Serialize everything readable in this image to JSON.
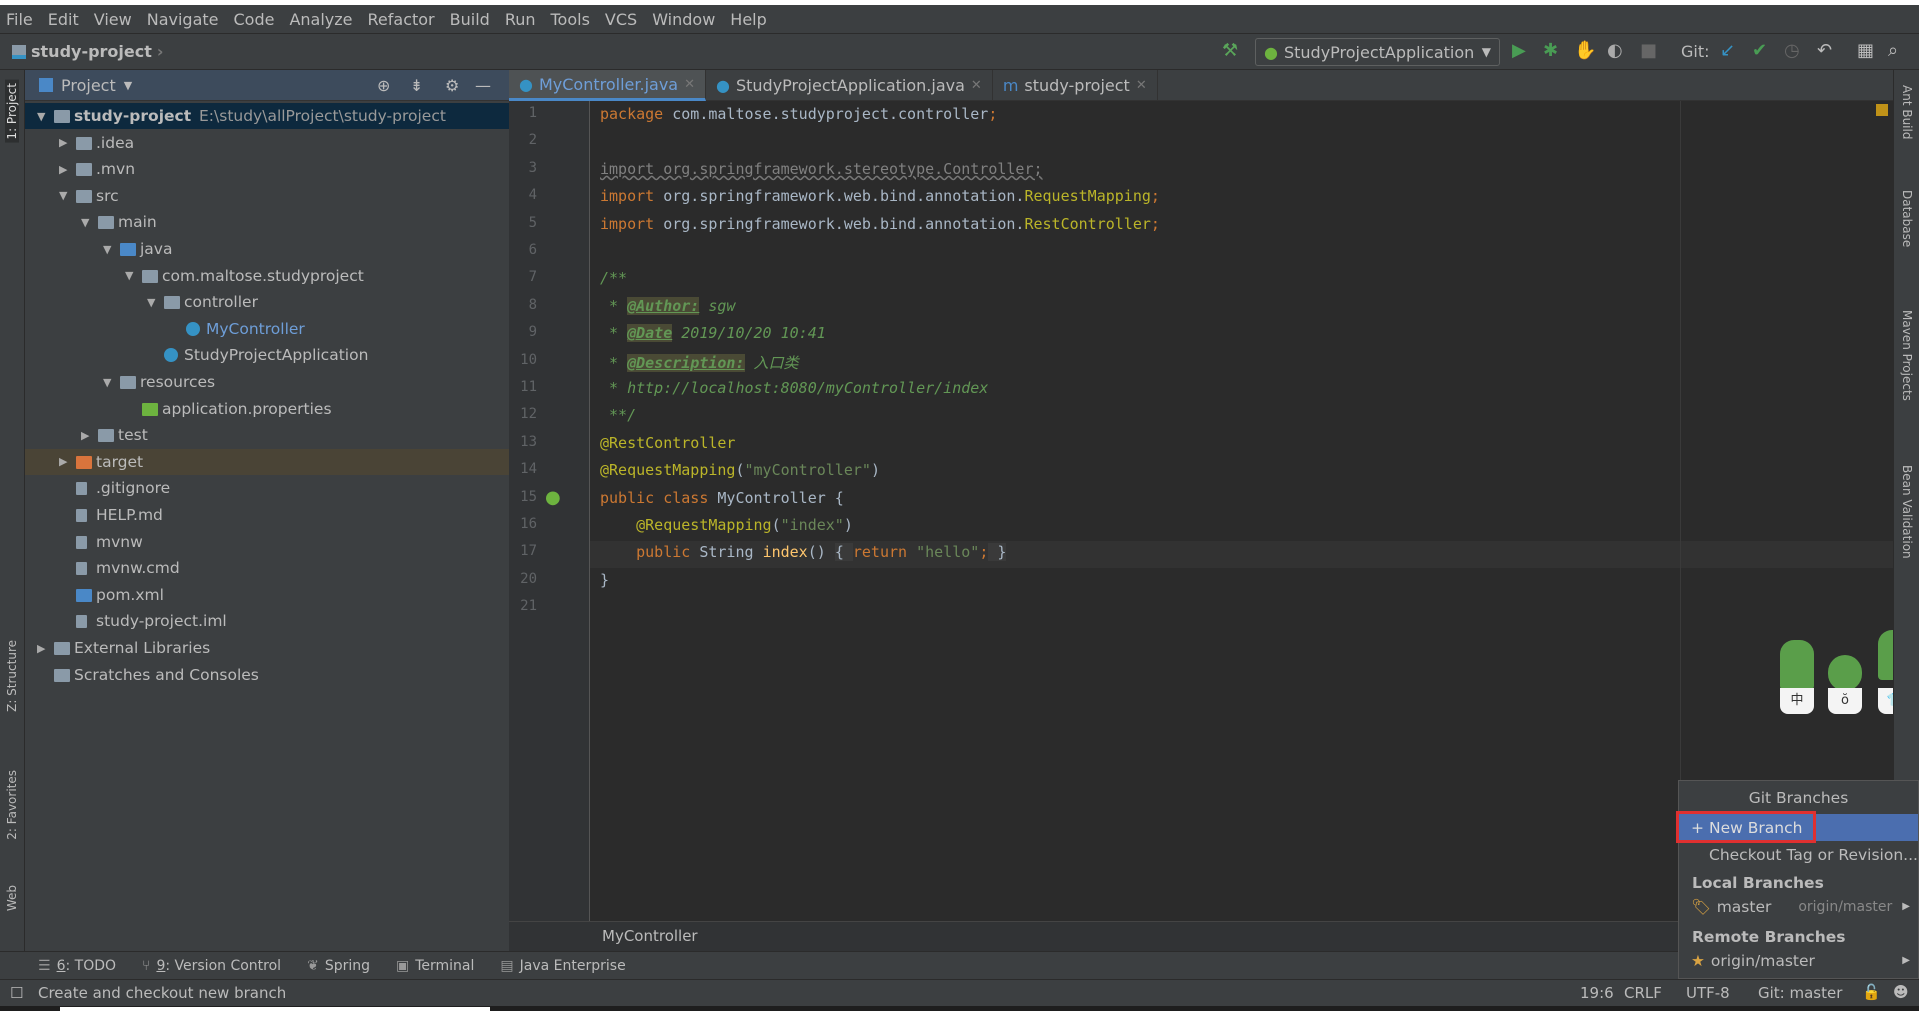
{
  "menu": [
    "File",
    "Edit",
    "View",
    "Navigate",
    "Code",
    "Analyze",
    "Refactor",
    "Build",
    "Run",
    "Tools",
    "VCS",
    "Window",
    "Help"
  ],
  "nav": {
    "project": "study-project"
  },
  "toolbar": {
    "run_config": "StudyProjectApplication",
    "git_label": "Git:"
  },
  "left_stripe": [
    "1: Project",
    "Z: Structure",
    "2: Favorites",
    "Web"
  ],
  "right_stripe": [
    "Ant Build",
    "Database",
    "Maven Projects",
    "Bean Validation"
  ],
  "project_panel": {
    "title": "Project",
    "tree": [
      {
        "level": 0,
        "label": "study-project",
        "path": "E:\\study\\allProject\\study-project",
        "kind": "module",
        "state": "open",
        "sel": true
      },
      {
        "level": 1,
        "label": ".idea",
        "kind": "folder",
        "state": "closed"
      },
      {
        "level": 1,
        "label": ".mvn",
        "kind": "folder",
        "state": "closed"
      },
      {
        "level": 1,
        "label": "src",
        "kind": "folder",
        "state": "open"
      },
      {
        "level": 2,
        "label": "main",
        "kind": "folder",
        "state": "open"
      },
      {
        "level": 3,
        "label": "java",
        "kind": "srcfolder",
        "state": "open"
      },
      {
        "level": 4,
        "label": "com.maltose.studyproject",
        "kind": "package",
        "state": "open"
      },
      {
        "level": 5,
        "label": "controller",
        "kind": "package",
        "state": "open"
      },
      {
        "level": 6,
        "label": "MyController",
        "kind": "class",
        "color": "#6e9ed8"
      },
      {
        "level": 5,
        "label": "StudyProjectApplication",
        "kind": "springclass"
      },
      {
        "level": 3,
        "label": "resources",
        "kind": "resfolder",
        "state": "open"
      },
      {
        "level": 4,
        "label": "application.properties",
        "kind": "props"
      },
      {
        "level": 2,
        "label": "test",
        "kind": "folder",
        "state": "closed"
      },
      {
        "level": 1,
        "label": "target",
        "kind": "excluded",
        "state": "closed",
        "excl": true
      },
      {
        "level": 1,
        "label": ".gitignore",
        "kind": "file"
      },
      {
        "level": 1,
        "label": "HELP.md",
        "kind": "md"
      },
      {
        "level": 1,
        "label": "mvnw",
        "kind": "file"
      },
      {
        "level": 1,
        "label": "mvnw.cmd",
        "kind": "file"
      },
      {
        "level": 1,
        "label": "pom.xml",
        "kind": "maven"
      },
      {
        "level": 1,
        "label": "study-project.iml",
        "kind": "file"
      },
      {
        "level": 0,
        "label": "External Libraries",
        "kind": "libs",
        "state": "closed"
      },
      {
        "level": 0,
        "label": "Scratches and Consoles",
        "kind": "scratch"
      }
    ]
  },
  "tabs": [
    {
      "label": "MyController.java",
      "active": true
    },
    {
      "label": "StudyProjectApplication.java"
    },
    {
      "label": "study-project"
    }
  ],
  "code": [
    {
      "n": "1",
      "t": [
        [
          "kw",
          "package "
        ],
        [
          "",
          "com.maltose.studyproject.controller"
        ],
        [
          "kw",
          ";"
        ]
      ]
    },
    {
      "n": "2",
      "t": []
    },
    {
      "n": "3",
      "t": [
        [
          "unused",
          "import org.springframework.stereotype.Controller;"
        ]
      ]
    },
    {
      "n": "4",
      "t": [
        [
          "kw",
          "import "
        ],
        [
          "",
          "org.springframework.web.bind.annotation."
        ],
        [
          "cls",
          "RequestMapping"
        ],
        [
          "kw",
          ";"
        ]
      ]
    },
    {
      "n": "5",
      "t": [
        [
          "kw",
          "import "
        ],
        [
          "",
          "org.springframework.web.bind.annotation."
        ],
        [
          "cls",
          "RestController"
        ],
        [
          "kw",
          ";"
        ]
      ]
    },
    {
      "n": "6",
      "t": []
    },
    {
      "n": "7",
      "t": [
        [
          "doc",
          "/**"
        ]
      ]
    },
    {
      "n": "8",
      "t": [
        [
          "doc",
          " * "
        ],
        [
          "tag",
          "@Author:"
        ],
        [
          "doc",
          " sgw"
        ]
      ]
    },
    {
      "n": "9",
      "t": [
        [
          "doc",
          " * "
        ],
        [
          "tag",
          "@Date"
        ],
        [
          "doc",
          " 2019/10/20 10:41"
        ]
      ]
    },
    {
      "n": "10",
      "t": [
        [
          "doc",
          " * "
        ],
        [
          "tag",
          "@Description:"
        ],
        [
          "doc",
          " 入口类"
        ]
      ]
    },
    {
      "n": "11",
      "t": [
        [
          "doc",
          " * http://localhost:8080/myController/index"
        ]
      ]
    },
    {
      "n": "12",
      "t": [
        [
          "doc",
          " **/"
        ]
      ]
    },
    {
      "n": "13",
      "t": [
        [
          "ann",
          "@RestController"
        ]
      ]
    },
    {
      "n": "14",
      "t": [
        [
          "ann",
          "@RequestMapping"
        ],
        [
          "",
          "("
        ],
        [
          "str",
          "\"myController\""
        ],
        [
          "",
          ")"
        ]
      ]
    },
    {
      "n": "15",
      "t": [
        [
          "kw",
          "public class "
        ],
        [
          "",
          "MyController {"
        ]
      ]
    },
    {
      "n": "16",
      "t": [
        [
          "",
          "    "
        ],
        [
          "ann",
          "@RequestMapping"
        ],
        [
          "",
          "("
        ],
        [
          "str",
          "\"index\""
        ],
        [
          "",
          ")"
        ]
      ]
    },
    {
      "n": "17",
      "t": [
        [
          "",
          "    "
        ],
        [
          "kw",
          "public "
        ],
        [
          "",
          "String "
        ],
        [
          "fn",
          "index"
        ],
        [
          "",
          "() "
        ],
        [
          "fold",
          "{ "
        ],
        [
          "kw",
          "return "
        ],
        [
          "str",
          "\"hello\""
        ],
        [
          "kw",
          ";"
        ],
        [
          "fold",
          " }"
        ]
      ]
    },
    {
      "n": "20",
      "t": [
        [
          "",
          "}"
        ]
      ]
    },
    {
      "n": "21",
      "t": []
    }
  ],
  "editor_breadcrumb": "MyController",
  "bottom_tools": [
    {
      "icon": "todo-icon",
      "key": "6",
      "label": ": TODO"
    },
    {
      "icon": "version-control-icon",
      "key": "9",
      "label": ": Version Control"
    },
    {
      "icon": "spring-icon",
      "key": "",
      "label": "Spring"
    },
    {
      "icon": "terminal-icon",
      "key": "",
      "label": "Terminal"
    },
    {
      "icon": "java-enterprise-icon",
      "key": "",
      "label": "Java Enterprise"
    }
  ],
  "status": {
    "message": "Create and checkout new branch",
    "position": "19:6",
    "line_sep": "CRLF",
    "encoding": "UTF-8",
    "git": "Git: master"
  },
  "git_popup": {
    "title": "Git Branches",
    "new_branch": "New Branch",
    "checkout": "Checkout Tag or Revision...",
    "local_header": "Local Branches",
    "local": [
      {
        "name": "master",
        "tracking": "origin/master"
      }
    ],
    "remote_header": "Remote Branches",
    "remote": [
      {
        "name": "origin/master"
      }
    ]
  },
  "colors": {
    "accent": "#4b6eaf",
    "highlight_box": "#e03030",
    "editor_bg": "#2b2b2b",
    "panel_bg": "#3c3f41"
  }
}
